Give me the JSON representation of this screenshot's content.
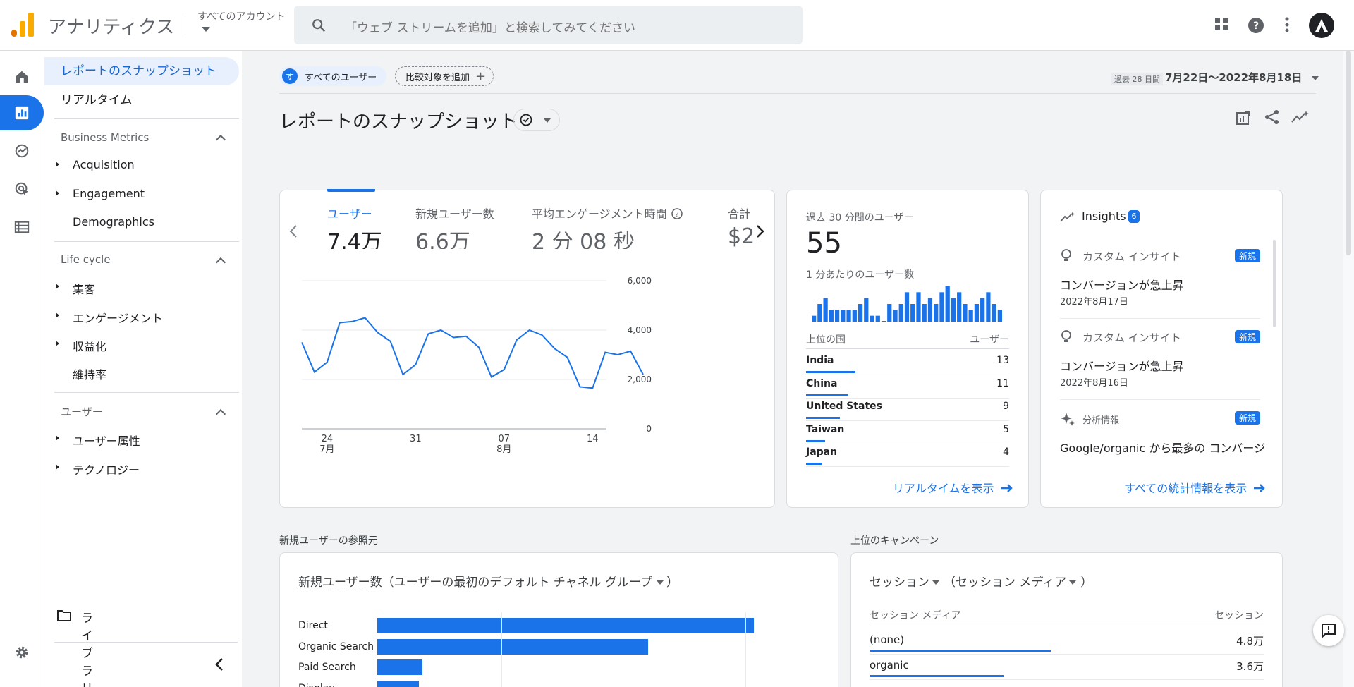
{
  "header": {
    "app_title": "アナリティクス",
    "account_label": "すべてのアカウント",
    "search_placeholder": "「ウェブ ストリームを追加」と検索してみてください"
  },
  "nav": {
    "report_snapshot": "レポートのスナップショット",
    "realtime": "リアルタイム",
    "sections": [
      {
        "title": "Business Metrics",
        "items": [
          "Acquisition",
          "Engagement",
          "Demographics"
        ]
      },
      {
        "title": "Life cycle",
        "items": [
          "集客",
          "エンゲージメント",
          "収益化",
          "維持率"
        ]
      },
      {
        "title": "ユーザー",
        "items": [
          "ユーザー属性",
          "テクノロジー"
        ]
      }
    ],
    "library": "ライブラリ"
  },
  "toolbar": {
    "chip_initial": "す",
    "chip_all_users": "すべてのユーザー",
    "chip_add_compare": "比較対象を追加",
    "date_prefix": "過去 28 日間",
    "date_range": "7月22日～2022年8月18日"
  },
  "page_title": "レポートのスナップショット",
  "metrics": [
    {
      "label": "ユーザー",
      "value": "7.4万"
    },
    {
      "label": "新規ユーザー数",
      "value": "6.6万"
    },
    {
      "label": "平均エンゲージメント時間",
      "value": "2 分 08 秒"
    },
    {
      "label": "合計",
      "value": "$2"
    }
  ],
  "chart_data": [
    {
      "type": "line",
      "x": [
        "7/22",
        "7/23",
        "7/24",
        "7/25",
        "7/26",
        "7/27",
        "7/28",
        "7/29",
        "7/30",
        "7/31",
        "8/1",
        "8/2",
        "8/3",
        "8/4",
        "8/5",
        "8/6",
        "8/7",
        "8/8",
        "8/9",
        "8/10",
        "8/11",
        "8/12",
        "8/13",
        "8/14",
        "8/15",
        "8/16",
        "8/17",
        "8/18"
      ],
      "series": [
        {
          "values": [
            3500,
            2300,
            2700,
            4300,
            4350,
            4500,
            3900,
            3550,
            2200,
            2600,
            3850,
            4000,
            3700,
            3750,
            3300,
            2100,
            2400,
            3600,
            4000,
            3800,
            3250,
            2900,
            1700,
            1650,
            3100,
            3000,
            3150,
            2200
          ]
        }
      ],
      "y_ticks": [
        "6,000",
        "4,000",
        "2,000",
        "0"
      ],
      "ylim": [
        0,
        6000
      ],
      "x_tick_labels": [
        {
          "day": "24",
          "month": "7月"
        },
        {
          "day": "31",
          "month": ""
        },
        {
          "day": "07",
          "month": "8月"
        },
        {
          "day": "14",
          "month": ""
        }
      ]
    },
    {
      "type": "bar",
      "title": "1 分あたりのユーザー数",
      "values": [
        1,
        3,
        4,
        2,
        2,
        2,
        2,
        2,
        3,
        4,
        1,
        1,
        0,
        3,
        2,
        3,
        5,
        3,
        5,
        3,
        4,
        3,
        5,
        6,
        4,
        5,
        3,
        2,
        3,
        4,
        5,
        3,
        2
      ]
    },
    {
      "type": "bar",
      "orientation": "horizontal",
      "categories": [
        "Direct",
        "Organic Search",
        "Paid Search",
        "Display"
      ],
      "values": [
        100,
        72,
        12,
        11
      ]
    }
  ],
  "realtime": {
    "label": "過去 30 分間のユーザー",
    "value": "55",
    "per_minute_label": "1 分あたりのユーザー数",
    "col_country": "上位の国",
    "col_users": "ユーザー",
    "countries": [
      {
        "name": "India",
        "users": "13",
        "frac": 1.0
      },
      {
        "name": "China",
        "users": "11",
        "frac": 0.85
      },
      {
        "name": "United States",
        "users": "9",
        "frac": 0.69
      },
      {
        "name": "Taiwan",
        "users": "5",
        "frac": 0.38
      },
      {
        "name": "Japan",
        "users": "4",
        "frac": 0.31
      }
    ],
    "link": "リアルタイムを表示"
  },
  "insights": {
    "title": "Insights",
    "count": "6",
    "items": [
      {
        "kind": "カスタム インサイト",
        "badge": "新規",
        "headline": "コンバージョンが急上昇",
        "date": "2022年8月17日"
      },
      {
        "kind": "カスタム インサイト",
        "badge": "新規",
        "headline": "コンバージョンが急上昇",
        "date": "2022年8月16日"
      },
      {
        "kind": "分析情報",
        "badge": "新規",
        "headline": "Google/organic から最多の コンバージ",
        "date": ""
      }
    ],
    "link": "すべての統計情報を表示"
  },
  "new_users_section": {
    "label": "新規ユーザーの参照元",
    "card_metric": "新規ユーザー数",
    "card_dimension": "（ユーザーの最初のデフォルト チャネル グループ",
    "card_close": "）"
  },
  "campaigns_section": {
    "label": "上位のキャンペーン",
    "metric": "セッション",
    "dimension": "（セッション メディア",
    "close": "）",
    "col_dim": "セッション メディア",
    "col_metric": "セッション",
    "rows": [
      {
        "key": "(none)",
        "value": "4.8万",
        "frac": 0.46
      },
      {
        "key": "organic",
        "value": "3.6万",
        "frac": 0.34
      },
      {
        "key": "",
        "value": "—",
        "frac": 0
      }
    ]
  },
  "colors": {
    "accent": "#1a73e8",
    "logo_orange": "#f9ab00",
    "logo_dark": "#e37400"
  }
}
